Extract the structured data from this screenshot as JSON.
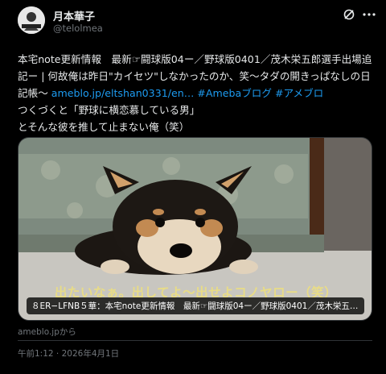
{
  "author": {
    "display_name": "月本華子",
    "handle": "@telolmea",
    "avatar_icon": "avatar-illustration"
  },
  "header_icons": [
    "grok-icon",
    "more-icon"
  ],
  "post": {
    "text_before_link": "本宅note更新情報　最新☞闘球版04ー／野球版0401／茂木栄五郎選手出場追記ー | 何故俺は昨日\"カイセツ\"しなかったのか、笑〜タダの開きっぱなしの日記帳〜 ",
    "link": "ameblo.jp/eltshan0331/en…",
    "hashtags": " #Amebaブログ #アメブロ",
    "line2": "つくづくと「野球に横恋慕している男」",
    "line3": "とそんな彼を推して止まない俺（笑）"
  },
  "card": {
    "image_caption": "出たいなぁ。出してよ〜出せよコノヤロー（笑）",
    "title": "８ER−LFNB５華：本宅note更新情報　最新☞闘球版04ー／野球版0401／茂木栄五郎選手…",
    "source": "ameblo.jpから"
  },
  "timestamp": "午前1:12 · 2026年4月1日",
  "colors": {
    "background": "#000000",
    "text": "#e7e9ea",
    "secondary": "#71767b",
    "link": "#1d9bf0",
    "border": "#2f3336"
  }
}
